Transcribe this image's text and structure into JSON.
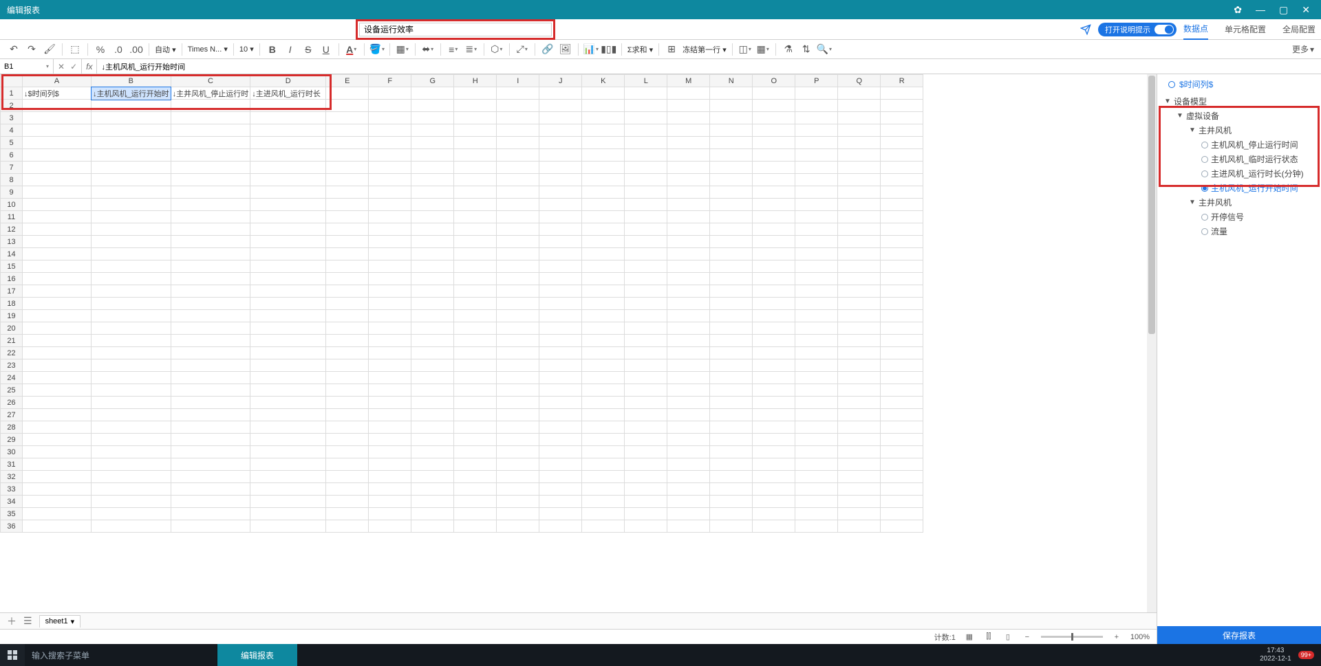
{
  "window": {
    "title": "编辑报表"
  },
  "report": {
    "name": "设备运行效率"
  },
  "hint": {
    "label": "打开说明提示"
  },
  "rightTabs": {
    "t1": "数据点",
    "t2": "单元格配置",
    "t3": "全局配置"
  },
  "toolbar": {
    "auto": "自动",
    "font": "Times N...",
    "size": "10",
    "sum": "Σ求和",
    "freeze": "冻结第一行",
    "more": "更多"
  },
  "namebox": "B1",
  "formula": "↓主机风机_运行开始时间",
  "columns": [
    "A",
    "B",
    "C",
    "D",
    "E",
    "F",
    "G",
    "H",
    "I",
    "J",
    "K",
    "L",
    "M",
    "N",
    "O",
    "P",
    "Q",
    "R"
  ],
  "row1": {
    "A": "↓$时间列$",
    "B": "↓主机风机_运行开始时",
    "C": "↓主井风机_停止运行时",
    "D": "↓主进风机_运行时长"
  },
  "sidepanel": {
    "timecol": "$时间列$",
    "root": "设备模型",
    "n_virtual": "虚拟设备",
    "n_mainfan": "主井风机",
    "leaf1": "主机风机_停止运行时间",
    "leaf2": "主机风机_临时运行状态",
    "leaf3": "主进风机_运行时长(分钟)",
    "leaf4": "主机风机_运行开始时间",
    "n_mainfan2": "主井风机",
    "leaf5": "开停信号",
    "leaf6": "流量",
    "save": "保存报表"
  },
  "sheetTabs": {
    "s1": "sheet1"
  },
  "status": {
    "count_label": "计数:",
    "count_val": "1",
    "zoom": "100%"
  },
  "taskbar": {
    "search_ph": "输入搜索子菜单",
    "app": "编辑报表",
    "time": "17:43",
    "date": "2022-12-1",
    "badge": "99+"
  }
}
